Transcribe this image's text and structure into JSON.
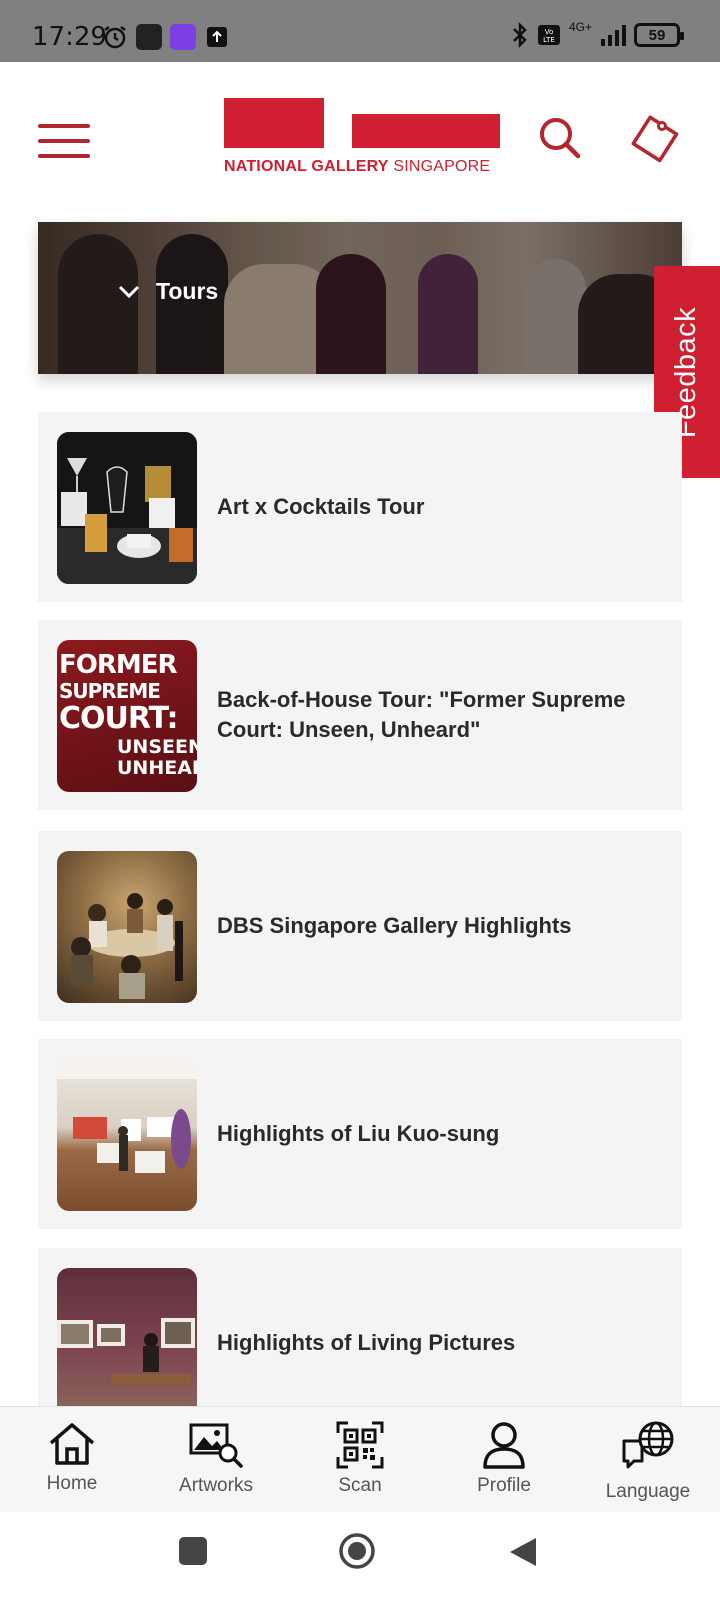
{
  "status_bar": {
    "time": "17:29",
    "battery": "59",
    "network": "4G+"
  },
  "header": {
    "logo_text_bold": "NATIONAL GALLERY",
    "logo_text_light": "SINGAPORE",
    "icons": [
      "menu-icon",
      "search-icon",
      "ticket-icon"
    ],
    "accent_color": "#d01f30"
  },
  "banner": {
    "title": "Tours"
  },
  "feedback": {
    "label": "Feedback"
  },
  "tours": [
    {
      "title": "Art x Cocktails Tour"
    },
    {
      "title": "Back-of-House Tour: \"Former Supreme Court: Unseen, Unheard\"",
      "thumb_text": [
        "FORMER",
        "SUPREME",
        "COURT:",
        "UNSEEN,",
        "UNHEARD"
      ]
    },
    {
      "title": "DBS Singapore Gallery Highlights"
    },
    {
      "title": "Highlights of Liu Kuo-sung"
    },
    {
      "title": "Highlights of Living Pictures"
    }
  ],
  "bottom_nav": {
    "items": [
      {
        "label": "Home",
        "icon": "home-icon"
      },
      {
        "label": "Artworks",
        "icon": "artworks-icon"
      },
      {
        "label": "Scan",
        "icon": "qr-code-icon"
      },
      {
        "label": "Profile",
        "icon": "profile-icon"
      },
      {
        "label": "Language",
        "icon": "language-icon"
      }
    ]
  }
}
